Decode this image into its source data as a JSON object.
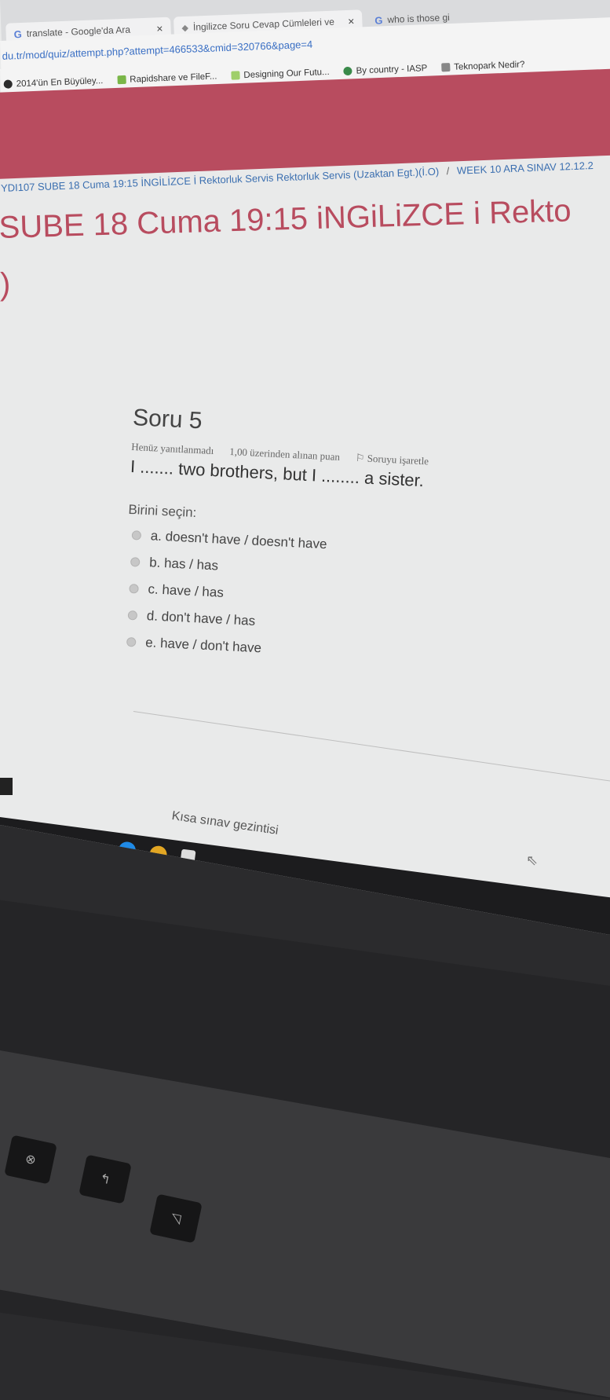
{
  "browser": {
    "tabs": [
      {
        "label": "translate - Google'da Ara",
        "icon": "google-icon"
      },
      {
        "label": "İngilizce Soru Cevap Cümleleri ve",
        "icon": "moodle-icon"
      },
      {
        "label": "who is those gi",
        "icon": "google-icon"
      }
    ],
    "tab_close": "×",
    "address": "du.tr/mod/quiz/attempt.php?attempt=466533&cmid=320766&page=4",
    "bookmarks": [
      {
        "label": "2014'ün En Büyüley...",
        "icon": "bookmark-icon"
      },
      {
        "label": "Rapidshare ve FileF...",
        "icon": "bookmark-icon"
      },
      {
        "label": "Designing Our Futu...",
        "icon": "bookmark-icon"
      },
      {
        "label": "By country - IASP",
        "icon": "globe-icon"
      },
      {
        "label": "Teknopark Nedir?",
        "icon": "bookmark-icon"
      }
    ]
  },
  "breadcrumb": {
    "course": "YDI107 SUBE 18 Cuma 19:15 İNGİLİZCE İ Rektorluk Servis Rektorluk Servis (Uzaktan Egt.)(İ.O)",
    "separator": "/",
    "current": "WEEK 10 ARA SINAV 12.12.2"
  },
  "page_title": "SUBE 18 Cuma 19:15 iNGiLiZCE i Rekto",
  "page_title_cont": ")",
  "question": {
    "number": "Soru 5",
    "status": "Henüz yanıtlanmadı",
    "points": "1,00 üzerinden alınan puan",
    "flag_label": "Soruyu işaretle",
    "text": "I ....... two brothers, but I ........ a sister.",
    "prompt": "Birini seçin:",
    "options": [
      "a. doesn't have / doesn't have",
      "b. has / has",
      "c. have / has",
      "d. don't have / has",
      "e. have / don't have"
    ]
  },
  "quiz_navigation": "Kısa sınav gezintisi",
  "colors": {
    "brand": "#b84c5f",
    "link": "#3b6fb0",
    "text": "#444444",
    "background": "#e9eaea"
  }
}
